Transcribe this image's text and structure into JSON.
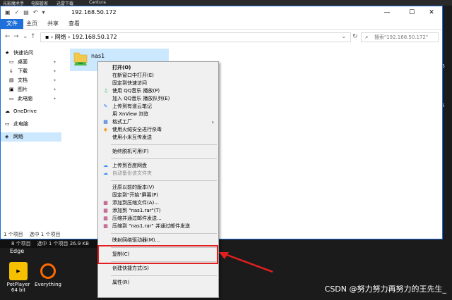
{
  "desktop": {
    "top_strip": [
      "光影魔术手",
      "电脑管家",
      "迅雷下载",
      "Cantura"
    ],
    "right_texts": [
      "B",
      "6"
    ],
    "edge_label": "Edge",
    "icons": [
      {
        "label": "PotPlayer 64 bit",
        "color": "#f5c000"
      },
      {
        "label": "Everything",
        "color": "#ff6a00"
      }
    ],
    "lower_status": {
      "items": "8 个项目",
      "selected": "选中 1 个项目 26.9 KB"
    },
    "watermark": "CSDN @努力努力再努力的王先生_"
  },
  "window": {
    "title": "192.168.50.172",
    "controls": {
      "minimize": "—",
      "maximize": "☐",
      "close": "✕"
    },
    "tabs": [
      {
        "label": "文件",
        "active": true
      },
      {
        "label": "主页",
        "active": false
      },
      {
        "label": "共享",
        "active": false
      },
      {
        "label": "查看",
        "active": false
      }
    ],
    "address_path": [
      "网络",
      "192.168.50.172"
    ],
    "address_sep": "›",
    "search_placeholder": "搜索\"192.168.50.172\"",
    "sidebar": [
      {
        "label": "快速访问",
        "icon": "★",
        "level": 1,
        "pinned": false,
        "selected": false
      },
      {
        "label": "桌面",
        "icon": "▭",
        "level": 2,
        "pinned": true,
        "selected": false
      },
      {
        "label": "下载",
        "icon": "↓",
        "level": 2,
        "pinned": true,
        "selected": false
      },
      {
        "label": "文档",
        "icon": "▤",
        "level": 2,
        "pinned": true,
        "selected": false
      },
      {
        "label": "图片",
        "icon": "▣",
        "level": 2,
        "pinned": true,
        "selected": false
      },
      {
        "label": "此电脑",
        "icon": "▭",
        "level": 2,
        "pinned": true,
        "selected": false
      },
      {
        "label": "OneDrive",
        "icon": "☁",
        "level": 1,
        "pinned": false,
        "selected": false
      },
      {
        "label": "此电脑",
        "icon": "▭",
        "level": 1,
        "pinned": false,
        "selected": false
      },
      {
        "label": "网络",
        "icon": "◈",
        "level": 1,
        "pinned": false,
        "selected": true
      }
    ],
    "folder": {
      "name": "nas1"
    },
    "status": {
      "items": "1 个项目",
      "selected": "选中 1 个项目"
    }
  },
  "context_menu": {
    "items": [
      {
        "label": "打开(O)",
        "bold": true,
        "icon": "",
        "disabled": false,
        "arrow": false
      },
      {
        "label": "在新窗口中打开(E)",
        "icon": "",
        "disabled": false,
        "arrow": false
      },
      {
        "label": "固定到快速访问",
        "icon": "",
        "disabled": false,
        "arrow": false
      },
      {
        "label": "使用 QQ音乐 播放(P)",
        "icon": "qq-music-icon",
        "disabled": false,
        "arrow": false
      },
      {
        "label": "加入 QQ音乐 播放队列(E)",
        "icon": "",
        "disabled": false,
        "arrow": false
      },
      {
        "label": "上传到有道云笔记",
        "icon": "youdao-note-icon",
        "disabled": false,
        "arrow": false
      },
      {
        "label": "用 XnView 浏览",
        "icon": "",
        "disabled": false,
        "arrow": false
      },
      {
        "label": "格式工厂",
        "icon": "format-factory-icon",
        "disabled": false,
        "arrow": true
      },
      {
        "label": "使用火绒安全进行杀毒",
        "icon": "huorong-icon",
        "disabled": false,
        "arrow": false
      },
      {
        "label": "使用小米互传发送",
        "icon": "",
        "disabled": false,
        "arrow": false
      },
      {
        "sep": true
      },
      {
        "label": "始终脱机可用(F)",
        "icon": "",
        "disabled": false,
        "arrow": false
      },
      {
        "sep": true
      },
      {
        "label": "上传到百度网盘",
        "icon": "baidu-cloud-icon",
        "disabled": false,
        "arrow": false
      },
      {
        "label": "自动备份该文件夹",
        "icon": "baidu-cloud-icon",
        "disabled": true,
        "arrow": false
      },
      {
        "sep": true
      },
      {
        "label": "还原以前的版本(V)",
        "icon": "",
        "disabled": false,
        "arrow": false
      },
      {
        "label": "固定到\"开始\"屏幕(P)",
        "icon": "",
        "disabled": false,
        "arrow": false
      },
      {
        "label": "添加到压缩文件(A)...",
        "icon": "winrar-icon",
        "disabled": false,
        "arrow": false
      },
      {
        "label": "添加到 \"nas1.rar\"(T)",
        "icon": "winrar-icon",
        "disabled": false,
        "arrow": false
      },
      {
        "label": "压缩并通过邮件发送...",
        "icon": "winrar-icon",
        "disabled": false,
        "arrow": false
      },
      {
        "label": "压缩到 \"nas1.rar\" 并通过邮件发送",
        "icon": "winrar-icon",
        "disabled": false,
        "arrow": false
      },
      {
        "sep": true
      },
      {
        "label": "映射网络驱动器(M)...",
        "icon": "",
        "disabled": false,
        "arrow": false
      },
      {
        "sep": true
      },
      {
        "label": "复制(C)",
        "icon": "",
        "disabled": false,
        "arrow": false
      },
      {
        "sep": true
      },
      {
        "label": "创建快捷方式(S)",
        "icon": "",
        "disabled": false,
        "arrow": false
      },
      {
        "sep": true
      },
      {
        "label": "属性(R)",
        "icon": "",
        "disabled": false,
        "arrow": false
      }
    ]
  },
  "colors": {
    "accent": "#1e6fd9",
    "selection": "#cce8ff",
    "highlight": "#e02020"
  }
}
